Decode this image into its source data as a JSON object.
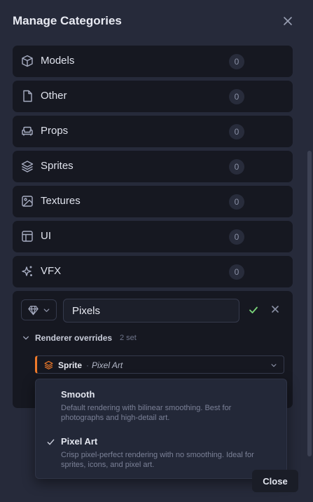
{
  "dialog": {
    "title": "Manage Categories"
  },
  "categories": [
    {
      "name": "Models",
      "count": "0",
      "icon": "cube-icon"
    },
    {
      "name": "Other",
      "count": "0",
      "icon": "file-icon"
    },
    {
      "name": "Props",
      "count": "0",
      "icon": "sofa-icon"
    },
    {
      "name": "Sprites",
      "count": "0",
      "icon": "layers-icon"
    },
    {
      "name": "Textures",
      "count": "0",
      "icon": "image-icon"
    },
    {
      "name": "UI",
      "count": "0",
      "icon": "layout-icon"
    },
    {
      "name": "VFX",
      "count": "0",
      "icon": "sparkles-icon"
    }
  ],
  "editor": {
    "name_value": "Pixels",
    "icon": "gem-icon",
    "overrides_label": "Renderer overrides",
    "overrides_count": "2 set",
    "override": {
      "type": "Sprite",
      "separator": "·",
      "value": "Pixel Art",
      "icon": "layers-icon"
    }
  },
  "dropdown": {
    "options": [
      {
        "label": "Smooth",
        "description": "Default rendering with bilinear smoothing. Best for photographs and high-detail art.",
        "selected": false
      },
      {
        "label": "Pixel Art",
        "description": "Crisp pixel-perfect rendering with no smoothing. Ideal for sprites, icons, and pixel art.",
        "selected": true
      }
    ]
  },
  "footer": {
    "close_label": "Close"
  },
  "colors": {
    "accent": "#f07a2a",
    "confirm": "#7bd67b",
    "panel": "#161821",
    "background": "#262a3a"
  }
}
